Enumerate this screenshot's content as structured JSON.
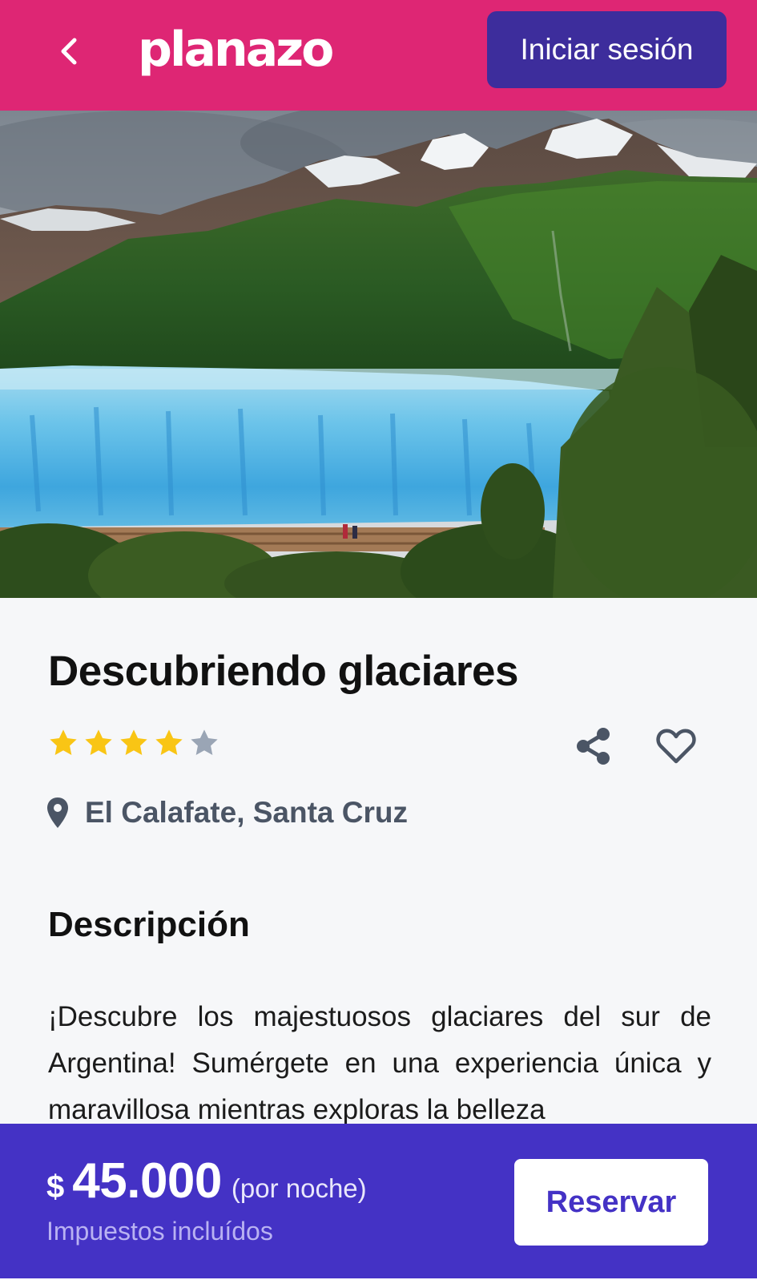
{
  "header": {
    "brand": "planazo",
    "login_label": "Iniciar sesión",
    "colors": {
      "background": "#de2674",
      "login_button": "#3d2d9c"
    }
  },
  "hero": {
    "alt": "Glaciar frente a montañas verdes con nieve"
  },
  "listing": {
    "title": "Descubriendo glaciares",
    "rating": 4,
    "rating_max": 5,
    "location": "El Calafate, Santa Cruz"
  },
  "description": {
    "heading": "Descripción",
    "text": "¡Descubre los majestuosos glaciares del sur de Argentina! Sumérgete en una experiencia única y maravillosa mientras exploras la belleza"
  },
  "booking": {
    "currency": "$",
    "price": "45.000",
    "unit": "(por noche)",
    "taxes": "Impuestos incluídos",
    "reserve_label": "Reservar",
    "colors": {
      "bar": "#4432c5"
    }
  },
  "icons": [
    "back-icon",
    "star-icon",
    "share-icon",
    "heart-icon",
    "location-pin-icon"
  ]
}
